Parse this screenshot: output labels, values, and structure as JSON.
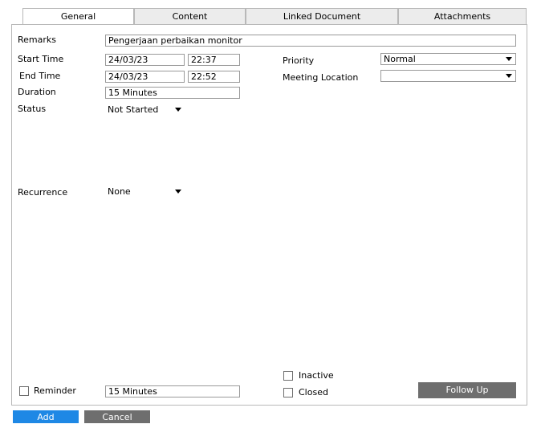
{
  "tabs": [
    {
      "label": "General"
    },
    {
      "label": "Content"
    },
    {
      "label": "Linked Document"
    },
    {
      "label": "Attachments"
    }
  ],
  "form": {
    "remarks_label": "Remarks",
    "remarks_value": "Pengerjaan perbaikan monitor",
    "start_time_label": "Start Time",
    "start_date": "24/03/23",
    "start_clock": "22:37",
    "end_time_label": "End Time",
    "end_date": "24/03/23",
    "end_clock": "22:52",
    "duration_label": "Duration",
    "duration_value": "15 Minutes",
    "status_label": "Status",
    "status_value": "Not Started",
    "priority_label": "Priority",
    "priority_value": "Normal",
    "meeting_location_label": "Meeting Location",
    "meeting_location_value": "",
    "recurrence_label": "Recurrence",
    "recurrence_value": "None",
    "reminder_label": "Reminder",
    "reminder_value": "15 Minutes",
    "inactive_label": "Inactive",
    "closed_label": "Closed",
    "follow_up_label": "Follow Up"
  },
  "footer": {
    "add_label": "Add",
    "cancel_label": "Cancel"
  },
  "colors": {
    "add_button": "#1e88e5",
    "cancel_button": "#6e6e6e",
    "follow_up_button": "#6e6e6e"
  }
}
